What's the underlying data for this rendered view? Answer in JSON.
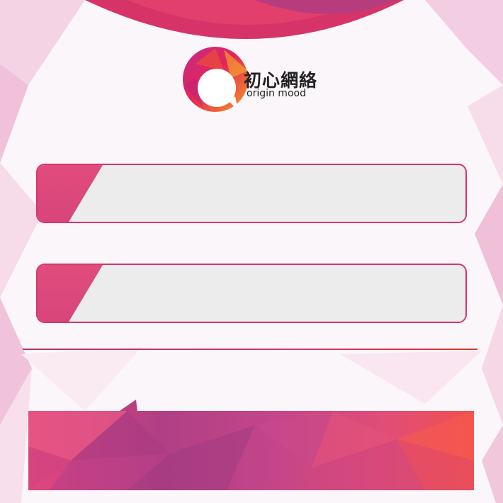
{
  "brand": {
    "name_cn": "初心網絡",
    "name_en": "origin mood",
    "logo_icon": "speech-bubble-logo-icon"
  },
  "form": {
    "username": {
      "value": "",
      "placeholder": ""
    },
    "password": {
      "value": "",
      "placeholder": ""
    },
    "submit_label": ""
  },
  "colors": {
    "accent": "#d6366d",
    "field_bg": "#ececec",
    "tab": "#e04c7c",
    "button_start": "#e2467d",
    "button_mid": "#b03f85",
    "button_end": "#f2504f"
  }
}
